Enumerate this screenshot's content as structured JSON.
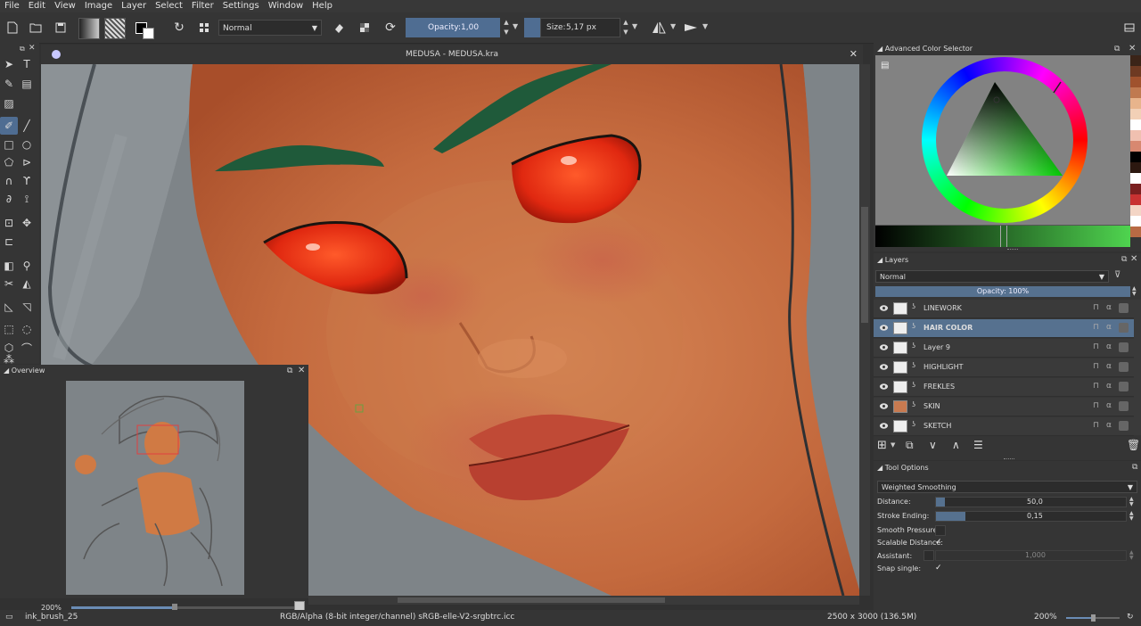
{
  "menus": [
    "File",
    "Edit",
    "View",
    "Image",
    "Layer",
    "Select",
    "Filter",
    "Settings",
    "Window",
    "Help"
  ],
  "toolbar": {
    "blend_mode": "Normal",
    "opacity_label": "Opacity:",
    "opacity_value": "1,00",
    "size_label": "Size:",
    "size_value": "5,17 px"
  },
  "canvas": {
    "title": "MEDUSA - MEDUSA.kra"
  },
  "overview": {
    "title": "Overview",
    "zoom": "200%"
  },
  "color_selector": {
    "title": "Advanced Color Selector",
    "palette": [
      "#3b2418",
      "#6e3a22",
      "#a0522d",
      "#c07a50",
      "#e8b48c",
      "#f2d0b6",
      "#ffffff",
      "#f0c0b0",
      "#d88870",
      "#000000",
      "#2c1810",
      "#ffffff",
      "#7a1f1f",
      "#c83232",
      "#f3d5c5",
      "#ffffff",
      "#b86a44"
    ]
  },
  "layers": {
    "title": "Layers",
    "blend_mode": "Normal",
    "opacity_text": "Opacity:  100%",
    "items": [
      {
        "name": "LINEWORK",
        "selected": false
      },
      {
        "name": "HAIR COLOR",
        "selected": true
      },
      {
        "name": "Layer 9",
        "selected": false
      },
      {
        "name": "HIGHLIGHT",
        "selected": false
      },
      {
        "name": "FREKLES",
        "selected": false
      },
      {
        "name": "SKIN",
        "selected": false
      },
      {
        "name": "SKETCH",
        "selected": false
      }
    ]
  },
  "tool_options": {
    "title": "Tool Options",
    "smoothing": "Weighted Smoothing",
    "distance_label": "Distance:",
    "distance_value": "50,0",
    "stroke_ending_label": "Stroke Ending:",
    "stroke_ending_value": "0,15",
    "smooth_pressure_label": "Smooth Pressure:",
    "scalable_distance_label": "Scalable Distance:",
    "scalable_distance_check": "✓",
    "assistant_label": "Assistant:",
    "assistant_value": "1,000",
    "snap_single_label": "Snap single:",
    "snap_single_check": "✓"
  },
  "status": {
    "brush": "ink_brush_25",
    "color_info": "RGB/Alpha (8-bit integer/channel)  sRGB-elle-V2-srgbtrc.icc",
    "dimensions": "2500 x 3000 (136.5M)",
    "zoom": "200%"
  }
}
